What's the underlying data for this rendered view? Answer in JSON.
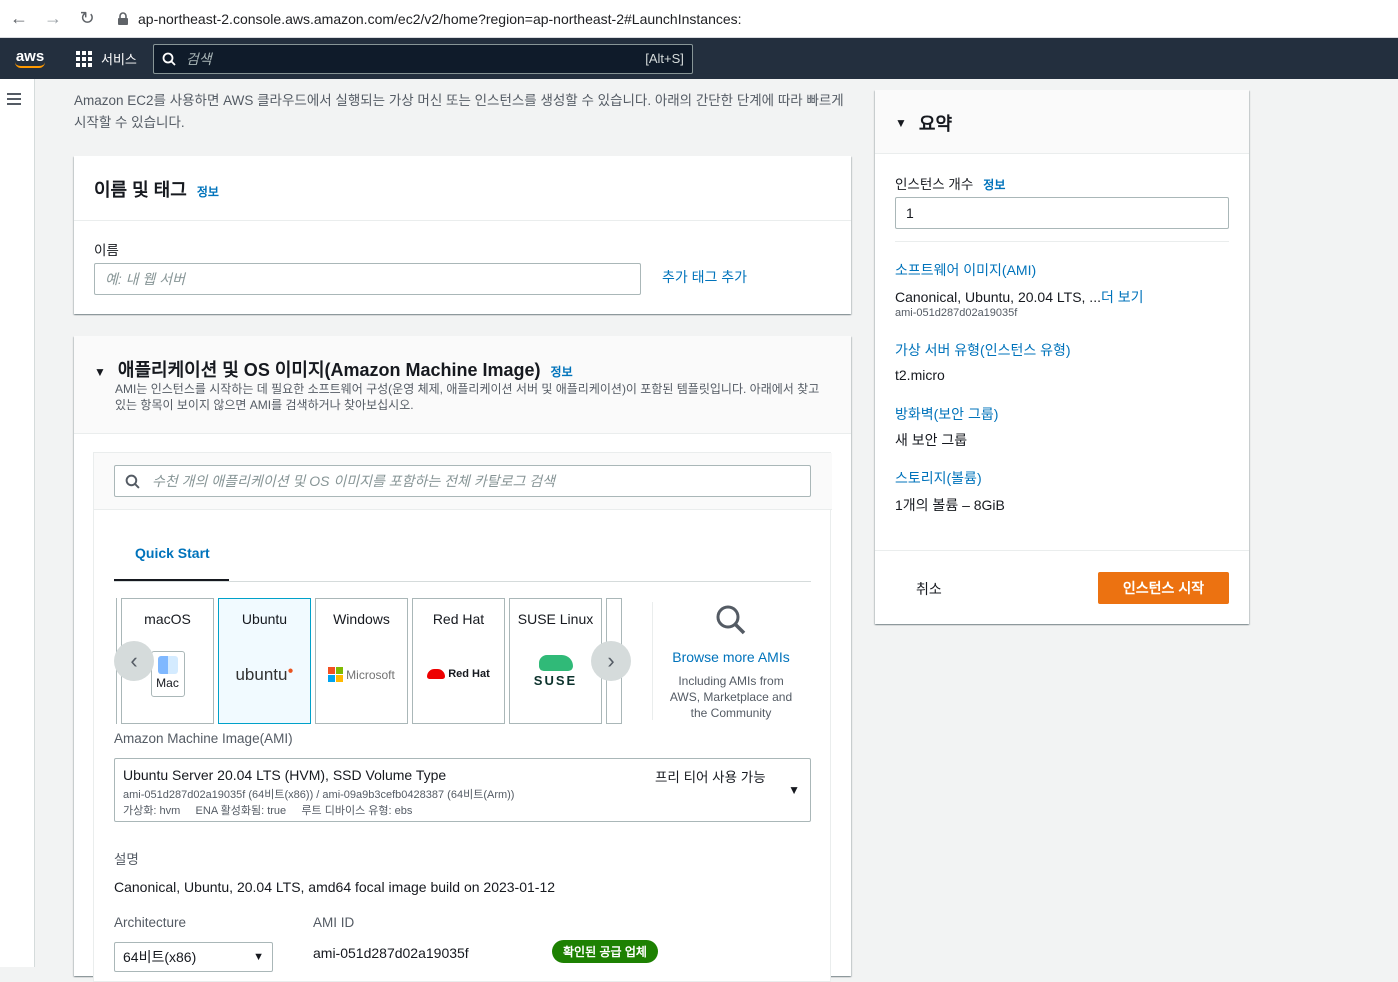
{
  "browser": {
    "url": "ap-northeast-2.console.aws.amazon.com/ec2/v2/home?region=ap-northeast-2#LaunchInstances:"
  },
  "header": {
    "logo": "aws",
    "services_label": "서비스",
    "search_placeholder": "검색",
    "search_shortcut": "[Alt+S]"
  },
  "intro": {
    "text": "Amazon EC2를 사용하면 AWS 클라우드에서 실행되는 가상 머신 또는 인스턴스를 생성할 수 있습니다. 아래의 간단한 단계에 따라 빠르게 시작할 수 있습니다."
  },
  "name_tags": {
    "title": "이름 및 태그",
    "info": "정보",
    "name_label": "이름",
    "name_placeholder": "예: 내 웹 서버",
    "add_tags": "추가 태그 추가"
  },
  "ami": {
    "title": "애플리케이션 및 OS 이미지(Amazon Machine Image)",
    "info": "정보",
    "description": "AMI는 인스턴스를 시작하는 데 필요한 소프트웨어 구성(운영 체제, 애플리케이션 서버 및 애플리케이션)이 포함된 템플릿입니다. 아래에서 찾고 있는 항목이 보이지 않으면 AMI를 검색하거나 찾아보십시오.",
    "search_placeholder": "수천 개의 애플리케이션 및 OS 이미지를 포함하는 전체 카탈로그 검색",
    "tab_quick_start": "Quick Start",
    "cards": [
      {
        "title": "macOS",
        "logo_text": "Mac"
      },
      {
        "title": "Ubuntu",
        "logo_text": "ubuntu"
      },
      {
        "title": "Windows",
        "logo_text": "Microsoft"
      },
      {
        "title": "Red Hat",
        "logo_text": "Red Hat"
      },
      {
        "title": "SUSE Linux",
        "logo_text": "SUSE"
      }
    ],
    "browse_more": "Browse more AMIs",
    "browse_sub": "Including AMIs from AWS, Marketplace and the Community",
    "ami_label": "Amazon Machine Image(AMI)",
    "selected": {
      "name": "Ubuntu Server 20.04 LTS (HVM), SSD Volume Type",
      "free_tier": "프리 티어 사용 가능",
      "ids": "ami-051d287d02a19035f (64비트(x86)) / ami-09a9b3cefb0428387 (64비트(Arm))",
      "meta": "가상화: hvm     ENA 활성화됨: true     루트 디바이스 유형: ebs"
    },
    "desc_label": "설명",
    "desc_value": "Canonical, Ubuntu, 20.04 LTS, amd64 focal image build on 2023-01-12",
    "arch_label": "Architecture",
    "arch_value": "64비트(x86)",
    "amiid_label": "AMI ID",
    "amiid_value": "ami-051d287d02a19035f",
    "verified_badge": "확인된 공급 업체"
  },
  "summary": {
    "title": "요약",
    "count_label": "인스턴스 개수",
    "count_info": "정보",
    "count_value": "1",
    "ami_link": "소프트웨어 이미지(AMI)",
    "ami_value": "Canonical, Ubuntu, 20.04 LTS, ...",
    "ami_more": "더 보기",
    "ami_id": "ami-051d287d02a19035f",
    "type_link": "가상 서버 유형(인스턴스 유형)",
    "type_value": "t2.micro",
    "fw_link": "방화벽(보안 그룹)",
    "fw_value": "새 보안 그룹",
    "storage_link": "스토리지(볼륨)",
    "storage_value": "1개의 볼륨 – 8GiB",
    "cancel": "취소",
    "launch": "인스턴스 시작"
  },
  "colors": {
    "aws_header": "#232f3e",
    "link": "#0073bb",
    "primary": "#ec7211",
    "badge": "#1d8102"
  }
}
